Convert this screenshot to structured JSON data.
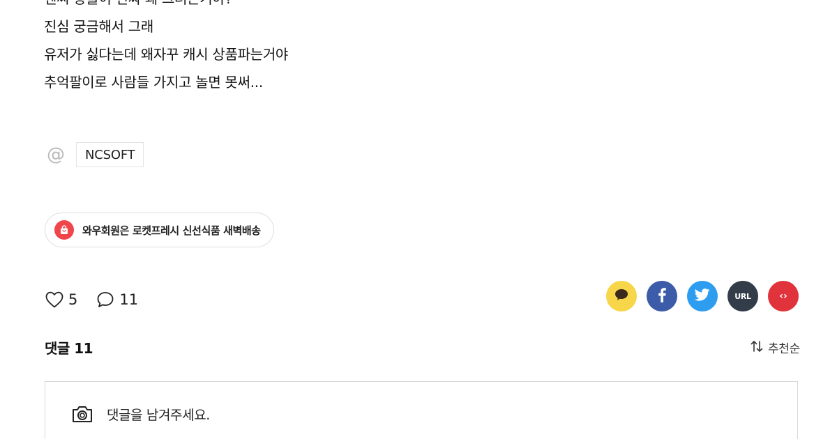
{
  "post": {
    "lines": [
      "엔씨 왕들이 진짜 왜 그러는거야?",
      "진심 궁금해서 그래",
      "유저가 싫다는데 왜자꾸 캐시 상품파는거야",
      "추억팔이로 사람들 가지고 놀면 못써..."
    ]
  },
  "tags": {
    "icon": "at-icon",
    "items": [
      "NCSOFT"
    ]
  },
  "promo": {
    "icon": "shopping-bag-icon",
    "label": "와우회원은 로켓프레시 신선식품 새벽배송",
    "accent": "#f0454b"
  },
  "reactions": {
    "likes": "5",
    "comments": "11"
  },
  "share": {
    "buttons": [
      {
        "name": "kakao",
        "icon": "speech-bubble-icon",
        "color": "#f8d64a"
      },
      {
        "name": "facebook",
        "icon": "facebook-icon",
        "color": "#3c5ba8"
      },
      {
        "name": "twitter",
        "icon": "twitter-bird-icon",
        "color": "#2e9df0"
      },
      {
        "name": "url",
        "label": "URL",
        "color": "#333c49"
      },
      {
        "name": "embed",
        "label": "‹›",
        "color": "#e0333b"
      }
    ]
  },
  "comments": {
    "title": "댓글 11",
    "sort_label": "추천순",
    "placeholder": "댓글을 남겨주세요."
  }
}
